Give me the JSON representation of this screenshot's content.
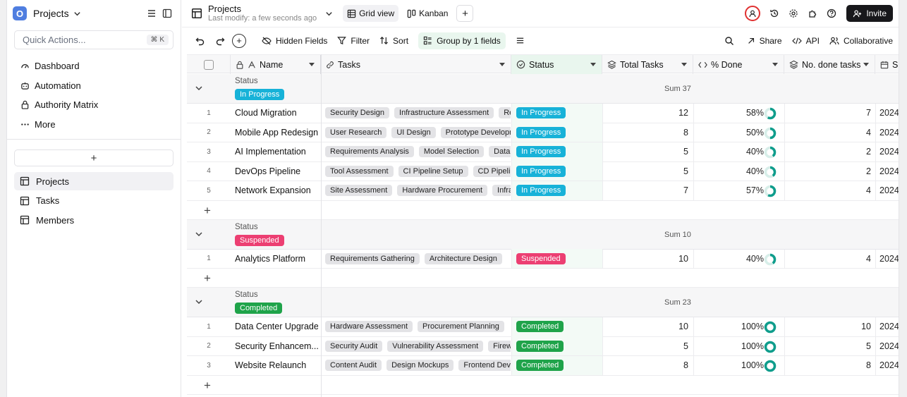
{
  "sidebar": {
    "logo_letter": "O",
    "workspace": "Projects",
    "quick_actions": {
      "placeholder": "Quick Actions...",
      "shortcut": "⌘ K"
    },
    "nav": [
      {
        "label": "Dashboard",
        "icon": "dashboard-icon"
      },
      {
        "label": "Automation",
        "icon": "robot-icon"
      },
      {
        "label": "Authority Matrix",
        "icon": "lock-icon"
      },
      {
        "label": "More",
        "icon": "more-icon"
      }
    ],
    "add_label": "+",
    "tables": [
      {
        "label": "Projects",
        "active": true
      },
      {
        "label": "Tasks",
        "active": false
      },
      {
        "label": "Members",
        "active": false
      }
    ]
  },
  "topbar": {
    "title": "Projects",
    "subtitle": "Last modify: a few seconds ago",
    "views": [
      {
        "label": "Grid view",
        "active": true
      },
      {
        "label": "Kanban",
        "active": false
      }
    ],
    "invite_label": "Invite"
  },
  "toolbar": {
    "hidden_fields": "Hidden Fields",
    "filter": "Filter",
    "sort": "Sort",
    "group": "Group by 1 fields",
    "share": "Share",
    "api": "API",
    "collaborative": "Collaborative"
  },
  "columns": {
    "name": "Name",
    "tasks": "Tasks",
    "status": "Status",
    "total": "Total Tasks",
    "pct": "% Done",
    "done": "No. done tasks",
    "start": "S"
  },
  "groups": [
    {
      "label": "Status",
      "value": "In Progress",
      "color": "#17b2d8",
      "sum": "Sum 37",
      "rows": [
        {
          "num": "1",
          "name": "Cloud Migration",
          "tasks": [
            "Security Design",
            "Infrastructure Assessment",
            "Re"
          ],
          "status": "In Progress",
          "total": "12",
          "pct": "58%",
          "pct_val": 0.58,
          "done": "7",
          "date": "2024"
        },
        {
          "num": "2",
          "name": "Mobile App Redesign",
          "tasks": [
            "User Research",
            "UI Design",
            "Prototype Developm"
          ],
          "status": "In Progress",
          "total": "8",
          "pct": "50%",
          "pct_val": 0.5,
          "done": "4",
          "date": "2024"
        },
        {
          "num": "3",
          "name": "AI Implementation",
          "tasks": [
            "Requirements Analysis",
            "Model Selection",
            "Data"
          ],
          "status": "In Progress",
          "total": "5",
          "pct": "40%",
          "pct_val": 0.4,
          "done": "2",
          "date": "2024"
        },
        {
          "num": "4",
          "name": "DevOps Pipeline",
          "tasks": [
            "Tool Assessment",
            "CI Pipeline Setup",
            "CD Pipelin"
          ],
          "status": "In Progress",
          "total": "5",
          "pct": "40%",
          "pct_val": 0.4,
          "done": "2",
          "date": "2024"
        },
        {
          "num": "5",
          "name": "Network Expansion",
          "tasks": [
            "Site Assessment",
            "Hardware Procurement",
            "Infra"
          ],
          "status": "In Progress",
          "total": "7",
          "pct": "57%",
          "pct_val": 0.57,
          "done": "4",
          "date": "2024"
        }
      ]
    },
    {
      "label": "Status",
      "value": "Suspended",
      "color": "#ec3f72",
      "sum": "Sum 10",
      "rows": [
        {
          "num": "1",
          "name": "Analytics Platform",
          "tasks": [
            "Requirements Gathering",
            "Architecture Design"
          ],
          "status": "Suspended",
          "total": "10",
          "pct": "40%",
          "pct_val": 0.4,
          "done": "4",
          "date": "2024"
        }
      ]
    },
    {
      "label": "Status",
      "value": "Completed",
      "color": "#1fa34a",
      "sum": "Sum 23",
      "rows": [
        {
          "num": "1",
          "name": "Data Center Upgrade",
          "tasks": [
            "Hardware Assessment",
            "Procurement Planning"
          ],
          "status": "Completed",
          "total": "10",
          "pct": "100%",
          "pct_val": 1.0,
          "done": "10",
          "date": "2024"
        },
        {
          "num": "2",
          "name": "Security Enhancem...",
          "tasks": [
            "Security Audit",
            "Vulnerability Assessment",
            "Firew"
          ],
          "status": "Completed",
          "total": "5",
          "pct": "100%",
          "pct_val": 1.0,
          "done": "5",
          "date": "2024"
        },
        {
          "num": "3",
          "name": "Website Relaunch",
          "tasks": [
            "Content Audit",
            "Design Mockups",
            "Frontend Deve"
          ],
          "status": "Completed",
          "total": "8",
          "pct": "100%",
          "pct_val": 1.0,
          "done": "8",
          "date": "2024"
        }
      ]
    }
  ],
  "colors": {
    "ring": "#0f9d8c",
    "ring_bg": "#d7eee9",
    "accent": "#e9f6ee"
  }
}
